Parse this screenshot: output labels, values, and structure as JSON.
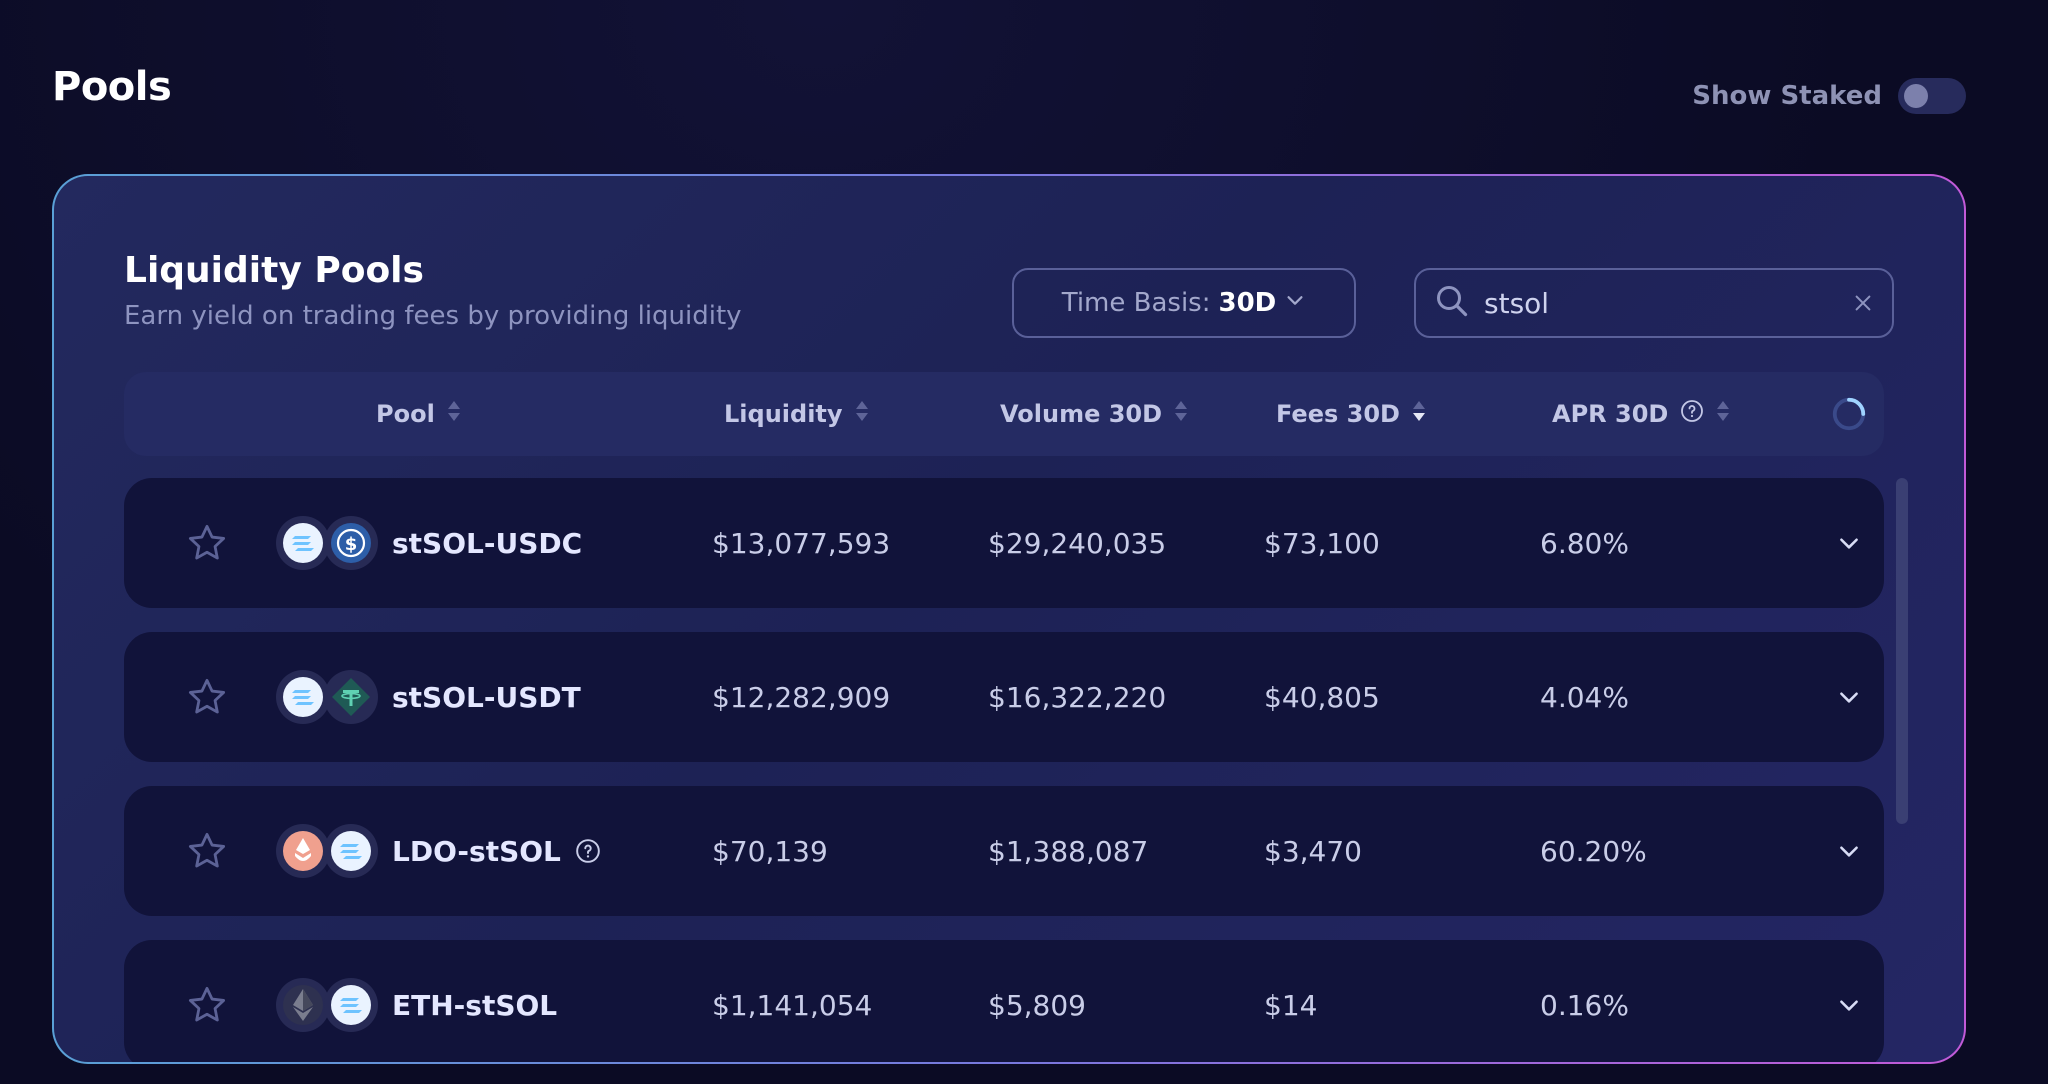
{
  "page": {
    "title": "Pools"
  },
  "show_staked": {
    "label": "Show Staked",
    "enabled": false
  },
  "card": {
    "title": "Liquidity Pools",
    "subtitle": "Earn yield on trading fees by providing liquidity"
  },
  "time_basis": {
    "label": "Time Basis:",
    "value": "30D"
  },
  "search": {
    "value": "stsol"
  },
  "columns": {
    "pool": "Pool",
    "liquidity": "Liquidity",
    "volume": "Volume 30D",
    "fees": "Fees 30D",
    "apr": "APR 30D"
  },
  "rows": [
    {
      "pool": "stSOL-USDC",
      "liquidity": "$13,077,593",
      "volume": "$29,240,035",
      "fees": "$73,100",
      "apr": "6.80%"
    },
    {
      "pool": "stSOL-USDT",
      "liquidity": "$12,282,909",
      "volume": "$16,322,220",
      "fees": "$40,805",
      "apr": "4.04%"
    },
    {
      "pool": "LDO-stSOL",
      "liquidity": "$70,139",
      "volume": "$1,388,087",
      "fees": "$3,470",
      "apr": "60.20%"
    },
    {
      "pool": "ETH-stSOL",
      "liquidity": "$1,141,054",
      "volume": "$5,809",
      "fees": "$14",
      "apr": "0.16%"
    }
  ],
  "icons": [
    "star-icon",
    "solana-icon",
    "usdc-icon",
    "usdt-icon",
    "ldo-icon",
    "eth-icon",
    "search-icon",
    "close-icon",
    "chevron-down-icon",
    "sort-icon",
    "help-icon",
    "refresh-icon"
  ],
  "colors": {
    "accent_start": "#5aa0d6",
    "accent_end": "#c25ad8",
    "row_bg": "#11133a"
  }
}
